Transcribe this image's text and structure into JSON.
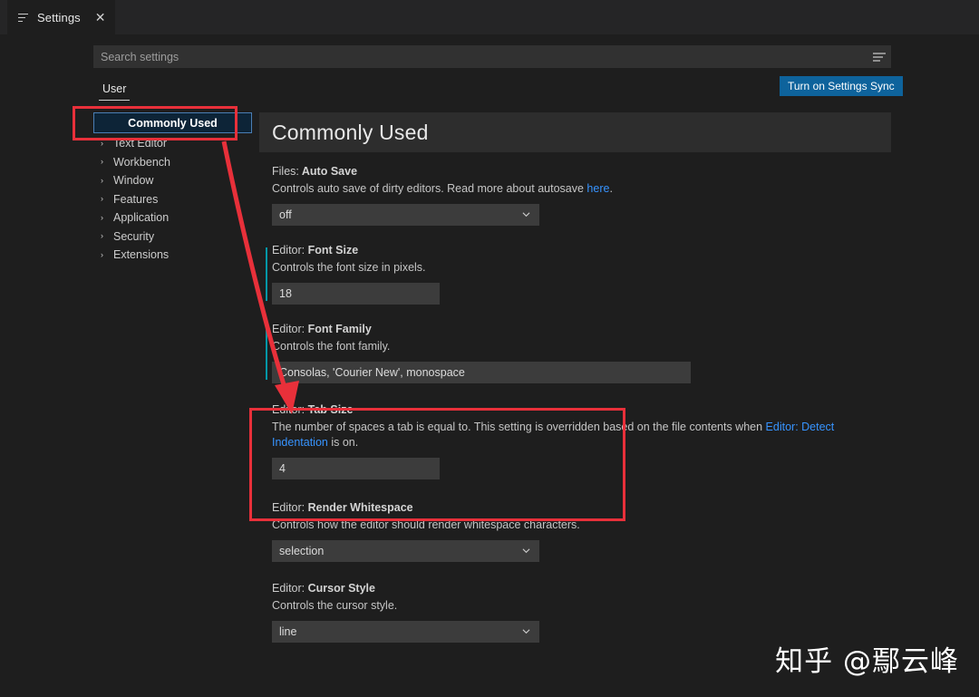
{
  "window": {
    "tab": {
      "label": "Settings",
      "icon": "settings-list-icon",
      "close_icon": "close-icon"
    }
  },
  "search": {
    "placeholder": "Search settings",
    "value": "",
    "filter_icon": "filter-icon"
  },
  "header": {
    "sync_button_label": "Turn on Settings Sync",
    "sync_button_color": "#0e639c"
  },
  "scope_tabs": [
    {
      "label": "User",
      "active": true
    }
  ],
  "sidebar": {
    "items": [
      {
        "label": "Commonly Used",
        "selected": true,
        "twisty": ""
      },
      {
        "label": "Text Editor",
        "selected": false,
        "twisty": "›"
      },
      {
        "label": "Workbench",
        "selected": false,
        "twisty": "›"
      },
      {
        "label": "Window",
        "selected": false,
        "twisty": "›"
      },
      {
        "label": "Features",
        "selected": false,
        "twisty": "›"
      },
      {
        "label": "Application",
        "selected": false,
        "twisty": "›"
      },
      {
        "label": "Security",
        "selected": false,
        "twisty": "›"
      },
      {
        "label": "Extensions",
        "selected": false,
        "twisty": "›"
      }
    ]
  },
  "main": {
    "section_title": "Commonly Used",
    "settings": [
      {
        "scope": "Files:",
        "name": "Auto Save",
        "desc_before": "Controls auto save of dirty editors. Read more about autosave ",
        "link": "here",
        "desc_after": ".",
        "control": "select",
        "value": "off",
        "modified": false
      },
      {
        "scope": "Editor:",
        "name": "Font Size",
        "desc_before": "Controls the font size in pixels.",
        "link": "",
        "desc_after": "",
        "control": "input-narrow",
        "value": "18",
        "modified": true
      },
      {
        "scope": "Editor:",
        "name": "Font Family",
        "desc_before": "Controls the font family.",
        "link": "",
        "desc_after": "",
        "control": "input-wide",
        "value": "Consolas, 'Courier New', monospace",
        "modified": true
      },
      {
        "scope": "Editor:",
        "name": "Tab Size",
        "desc_before": "The number of spaces a tab is equal to. This setting is overridden based on the file contents when ",
        "link": "Editor: Detect Indentation",
        "desc_after": " is on.",
        "control": "input-narrow",
        "value": "4",
        "modified": false
      },
      {
        "scope": "Editor:",
        "name": "Render Whitespace",
        "desc_before": "Controls how the editor should render whitespace characters.",
        "link": "",
        "desc_after": "",
        "control": "select",
        "value": "selection",
        "modified": false
      },
      {
        "scope": "Editor:",
        "name": "Cursor Style",
        "desc_before": "Controls the cursor style.",
        "link": "",
        "desc_after": "",
        "control": "select",
        "value": "line",
        "modified": false
      }
    ]
  },
  "annotations": {
    "accent_color": "#e8303a",
    "rect_sidebar_target": "Commonly Used",
    "rect_setting_target": "Editor: Tab Size",
    "arrow_from": "Commonly Used",
    "arrow_to": "Editor: Tab Size"
  },
  "watermark": {
    "text": "知乎 @鄢云峰"
  },
  "colors": {
    "background": "#1e1e1e",
    "titlebar": "#252526",
    "input": "#3c3c3c",
    "link": "#3794ff",
    "modified_indicator": "#0097a7",
    "selection_border": "#4a7eb5"
  }
}
